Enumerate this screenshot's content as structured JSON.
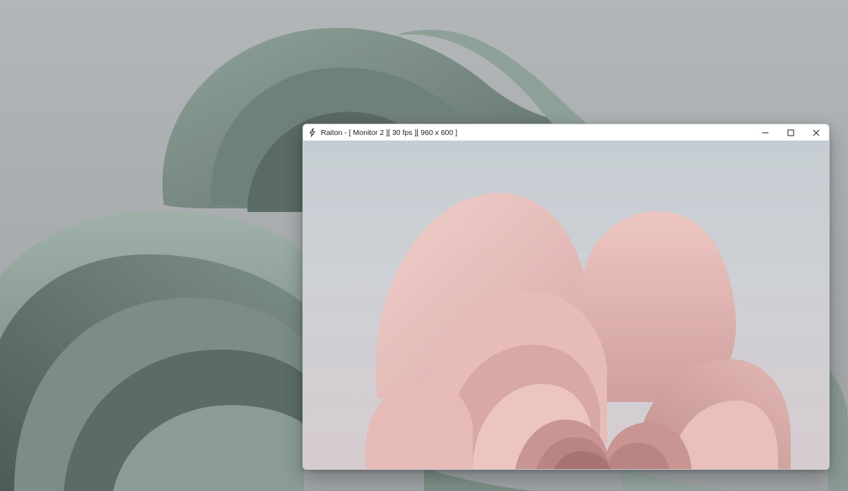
{
  "window": {
    "app_name": "Raiton",
    "title": "Raiton - [ Monitor 2 ][ 30 fps ][ 960 x 600 ]",
    "icon": "lightning-bolt-icon",
    "controls": {
      "minimize_icon": "minimize-icon",
      "maximize_icon": "maximize-icon",
      "close_icon": "close-icon"
    }
  },
  "desktop": {
    "wallpaper": "bloom-wallpaper-sage"
  },
  "capture": {
    "content": "bloom-wallpaper-pink"
  },
  "colors": {
    "desktop_bloom": "#7e9088",
    "capture_bloom": "#e8c3bf",
    "titlebar": "#ffffff"
  }
}
